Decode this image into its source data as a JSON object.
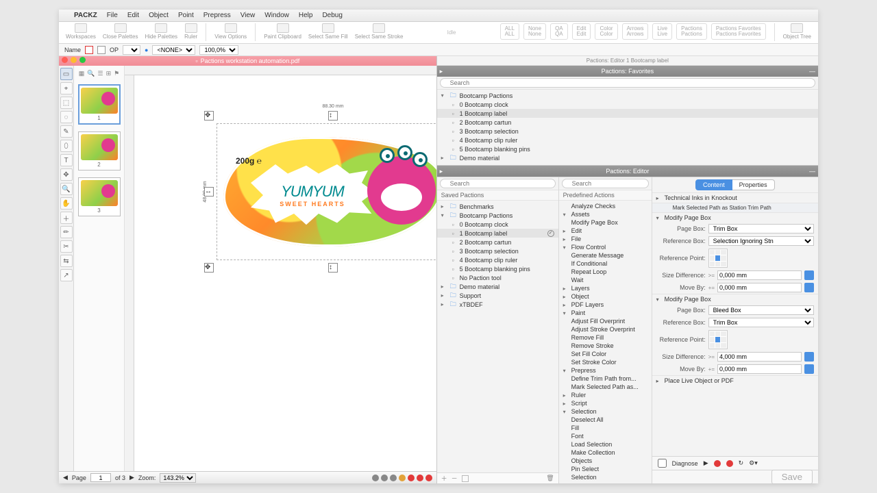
{
  "menubar": {
    "app": "PACKZ",
    "items": [
      "File",
      "Edit",
      "Object",
      "Point",
      "Prepress",
      "View",
      "Window",
      "Help",
      "Debug"
    ]
  },
  "toolbar": {
    "left": [
      {
        "label": "Workspaces"
      },
      {
        "label": "Close Palettes"
      },
      {
        "label": "Hide Palettes"
      },
      {
        "label": "Ruler"
      },
      {
        "label": "View Options"
      },
      {
        "label": "Paint Clipboard"
      },
      {
        "label": "Select Same Fill"
      },
      {
        "label": "Select Same Stroke"
      }
    ],
    "center": "Idle",
    "right": [
      {
        "t": "ALL",
        "b": "ALL"
      },
      {
        "t": "None",
        "b": "None"
      },
      {
        "t": "QA",
        "b": "QA"
      },
      {
        "t": "Edit",
        "b": "Edit"
      },
      {
        "t": "Color",
        "b": "Color"
      },
      {
        "t": "Arrows",
        "b": "Arrows"
      },
      {
        "t": "Live",
        "b": "Live"
      },
      {
        "t": "Pactions",
        "b": "Pactions"
      },
      {
        "t": "Pactions Favorites",
        "b": "Pactions Favorites"
      }
    ],
    "far_right": "Object Tree"
  },
  "optbar": {
    "name_label": "Name",
    "none_label": "<NONE>",
    "zoom": "100,0%",
    "op": "OP"
  },
  "document": {
    "title": "Pactions workstation automation.pdf",
    "thumbs": [
      {
        "n": "1"
      },
      {
        "n": "2"
      },
      {
        "n": "3"
      }
    ],
    "art": {
      "weight": "200g ℮",
      "brand": "YUMYUM",
      "tag": "SWEET HEARTS"
    },
    "dims": {
      "w": "88.30 mm",
      "h": "48.00 mm"
    },
    "status": {
      "page_label": "Page",
      "page": "1",
      "of": "of 3",
      "zoom_label": "Zoom:",
      "zoom": "143.2%"
    }
  },
  "favorites": {
    "title": "Pactions: Favorites",
    "sub": "Pactions: Editor  1 Bootcamp label",
    "search": "Search",
    "root": "Bootcamp Pactions",
    "items": [
      "0 Bootcamp clock",
      "1 Bootcamp label",
      "2 Bootcamp cartun",
      "3 Bootcamp selection",
      "4 Bootcamp clip ruler",
      "5 Bootcamp blanking pins"
    ],
    "demo": "Demo material"
  },
  "editor": {
    "title": "Pactions: Editor",
    "search": "Search",
    "saved_label": "Saved Pactions",
    "groups": {
      "benchmarks": "Benchmarks",
      "bootcamp": "Bootcamp Pactions",
      "items": [
        "0 Bootcamp clock",
        "1 Bootcamp label",
        "2 Bootcamp cartun",
        "3 Bootcamp selection",
        "4 Bootcamp clip ruler",
        "5 Bootcamp blanking pins",
        "No Paction tool"
      ],
      "demo": "Demo material",
      "support": "Support",
      "xtbdef": "xTBDEF"
    },
    "predef": {
      "label": "Predefined Actions",
      "search": "Search",
      "nodes": [
        {
          "t": "Analyze Checks",
          "leaf": true
        },
        {
          "t": "Assets",
          "open": true,
          "children": [
            "Modify Page Box"
          ]
        },
        {
          "t": "Edit",
          "leaf": false
        },
        {
          "t": "File",
          "leaf": false
        },
        {
          "t": "Flow Control",
          "open": true,
          "children": [
            "Generate Message",
            "If Conditional",
            "Repeat Loop",
            "Wait"
          ]
        },
        {
          "t": "Layers",
          "leaf": false
        },
        {
          "t": "Object",
          "leaf": false
        },
        {
          "t": "PDF Layers",
          "leaf": false
        },
        {
          "t": "Paint",
          "open": true,
          "children": [
            "Adjust Fill Overprint",
            "Adjust Stroke Overprint",
            "Remove Fill",
            "Remove Stroke",
            "Set Fill Color",
            "Set Stroke Color"
          ]
        },
        {
          "t": "Prepress",
          "open": true,
          "children": [
            "Define Trim Path from...",
            "Mark Selected Path as..."
          ]
        },
        {
          "t": "Ruler",
          "leaf": false
        },
        {
          "t": "Script",
          "leaf": false
        },
        {
          "t": "Selection",
          "open": true,
          "children": [
            "Deselect All",
            "Fill",
            "Font",
            "Load Selection",
            "Make Collection",
            "Objects",
            "Pin Select",
            "Selection"
          ]
        }
      ]
    },
    "props": {
      "tabs": {
        "content": "Content",
        "properties": "Properties"
      },
      "rows": [
        {
          "type": "accord",
          "label": "Technical Inks in Knockout"
        },
        {
          "type": "banner",
          "label": "Mark Selected Path as Station Trim Path"
        },
        {
          "type": "accord",
          "label": "Modify Page Box",
          "open": true
        },
        {
          "type": "field",
          "label": "Page Box:",
          "value": "Trim Box"
        },
        {
          "type": "field",
          "label": "Reference Box:",
          "value": "Selection Ignoring Stn"
        },
        {
          "type": "ref",
          "label": "Reference Point:"
        },
        {
          "type": "num",
          "label": "Size Difference:",
          "op": ">=",
          "value": "0,000 mm"
        },
        {
          "type": "num",
          "label": "Move By:",
          "op": "+=",
          "value": "0,000 mm"
        },
        {
          "type": "accord",
          "label": "Modify Page Box",
          "open": true
        },
        {
          "type": "field",
          "label": "Page Box:",
          "value": "Bleed Box"
        },
        {
          "type": "field",
          "label": "Reference Box:",
          "value": "Trim Box"
        },
        {
          "type": "ref",
          "label": "Reference Point:"
        },
        {
          "type": "num",
          "label": "Size Difference:",
          "op": ">=",
          "value": "4,000 mm"
        },
        {
          "type": "num",
          "label": "Move By:",
          "op": "+=",
          "value": "0,000 mm"
        },
        {
          "type": "accord",
          "label": "Place Live Object or PDF"
        }
      ],
      "bottom": {
        "diagnose": "Diagnose",
        "save": "Save"
      }
    }
  },
  "vtool_icons": [
    "▭",
    "⌖",
    "⬚",
    "◌",
    "✎",
    "⬯",
    "T",
    "✥",
    "🔍",
    "✋",
    "＋",
    "✏",
    "✂",
    "⇆",
    "↗"
  ]
}
